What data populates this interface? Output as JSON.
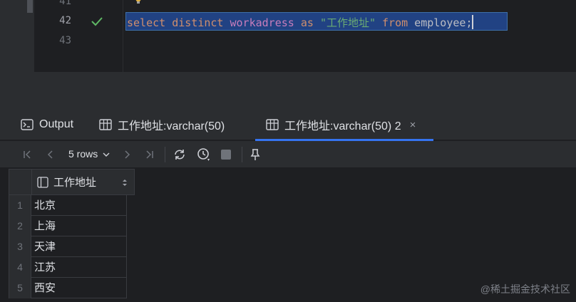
{
  "editor": {
    "line_numbers": [
      "41",
      "42",
      "43"
    ],
    "active_line": "42",
    "code": {
      "select": "select",
      "distinct": "distinct",
      "column": "workadress",
      "as": "as",
      "alias": "\"工作地址\"",
      "from": "from",
      "table": "employee",
      "semicolon": ";"
    }
  },
  "tabs": [
    {
      "label": "Output",
      "icon": "console-icon"
    },
    {
      "label": "工作地址:varchar(50)",
      "icon": "table-icon"
    },
    {
      "label": "工作地址:varchar(50) 2",
      "icon": "table-icon",
      "close": "×"
    }
  ],
  "toolbar": {
    "rows_label": "5 rows",
    "chevron": "⌵",
    "first": "|‹",
    "prev": "‹",
    "next": "›",
    "last": "›|"
  },
  "grid": {
    "column_header": "工作地址",
    "rows": [
      {
        "num": "1",
        "value": "北京"
      },
      {
        "num": "2",
        "value": "上海"
      },
      {
        "num": "3",
        "value": "天津"
      },
      {
        "num": "4",
        "value": "江苏"
      },
      {
        "num": "5",
        "value": "西安"
      }
    ]
  },
  "watermark": "@稀土掘金技术社区",
  "colors": {
    "accent": "#3574f0",
    "check": "#5fb865",
    "keyword": "#cf8e6d",
    "function": "#c77dbb",
    "string": "#6aab73"
  }
}
